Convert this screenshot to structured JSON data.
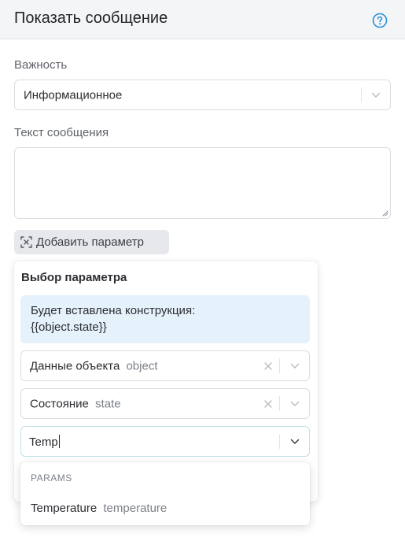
{
  "header": {
    "title": "Показать сообщение",
    "help_icon": "question-circle-icon"
  },
  "importance": {
    "label": "Важность",
    "value": "Информационное"
  },
  "message": {
    "label": "Текст сообщения",
    "value": ""
  },
  "add_param_button": {
    "label": "Добавить параметр",
    "icon": "variable-brackets-icon"
  },
  "param_picker": {
    "title": "Выбор параметра",
    "info_line1": "Будет вставлена конструкция:",
    "info_line2": "{{object.state}}",
    "object_select": {
      "label": "Данные объекта",
      "key": "object"
    },
    "state_select": {
      "label": "Состояние",
      "key": "state"
    },
    "search": {
      "value": "Temp"
    },
    "dropdown": {
      "group": "PARAMS",
      "options": [
        {
          "label": "Temperature",
          "key": "temperature"
        }
      ]
    }
  },
  "colors": {
    "accent": "#2b8fd6",
    "info_bg": "#e5f1fb",
    "header_bg": "#f4f5f7",
    "button_bg": "#e6e8eb"
  }
}
